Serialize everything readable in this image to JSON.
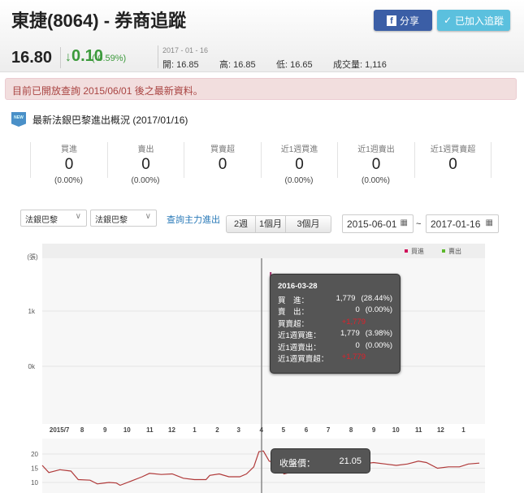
{
  "header": {
    "title": "東捷(8064) - 券商追蹤",
    "share_label": "分享",
    "track_label": "已加入追蹤"
  },
  "quote": {
    "price": "16.80",
    "change": "0.10",
    "change_pct": "(-0.59%)",
    "date": "2017 - 01 - 16",
    "open": "開: 16.85",
    "high": "高: 16.85",
    "low": "低: 16.65",
    "volume": "成交量: 1,116",
    "up_color": "#3c9a3c"
  },
  "alert": "目前已開放查詢 2015/06/01 後之最新資料。",
  "section": {
    "icon_text": "NEW",
    "title": "最新法銀巴黎進出概況 (2017/01/16)"
  },
  "stats": [
    {
      "label": "買進",
      "value": "0",
      "pct": "(0.00%)"
    },
    {
      "label": "賣出",
      "value": "0",
      "pct": "(0.00%)"
    },
    {
      "label": "買賣超",
      "value": "0",
      "pct": ""
    },
    {
      "label": "近1週買進",
      "value": "0",
      "pct": "(0.00%)"
    },
    {
      "label": "近1週賣出",
      "value": "0",
      "pct": "(0.00%)"
    },
    {
      "label": "近1週買賣超",
      "value": "0",
      "pct": ""
    }
  ],
  "controls": {
    "broker1": "法銀巴黎",
    "broker2": "法銀巴黎",
    "query_link": "查詢主力進出",
    "periods": [
      "2週",
      "1個月",
      "3個月"
    ],
    "date_from": "2015-06-01",
    "date_to": "2017-01-16",
    "tilde": "~"
  },
  "chart_data": [
    {
      "type": "bar",
      "title": "",
      "ylabel": "(張)",
      "yticks": [
        "1k",
        "0k"
      ],
      "legend": [
        {
          "name": "買進",
          "color": "#d0105a"
        },
        {
          "name": "賣出",
          "color": "#5cb82c"
        }
      ],
      "legend_position": "top-right",
      "x_range": [
        "2015-06-01",
        "2017-01-16"
      ],
      "x_ticks": [
        {
          "date": "2015-07-01",
          "label": "2015/7"
        },
        {
          "date": "2015-08-01",
          "label": "8"
        },
        {
          "date": "2015-09-01",
          "label": "9"
        },
        {
          "date": "2015-10-01",
          "label": "10"
        },
        {
          "date": "2015-11-01",
          "label": "11"
        },
        {
          "date": "2015-12-01",
          "label": "12"
        },
        {
          "date": "2016-01-01",
          "label": "1"
        },
        {
          "date": "2016-02-01",
          "label": "2"
        },
        {
          "date": "2016-03-01",
          "label": "3"
        },
        {
          "date": "2016-04-01",
          "label": "4"
        },
        {
          "date": "2016-05-01",
          "label": "5"
        },
        {
          "date": "2016-06-01",
          "label": "6"
        },
        {
          "date": "2016-07-01",
          "label": "7"
        },
        {
          "date": "2016-08-01",
          "label": "8"
        },
        {
          "date": "2016-09-01",
          "label": "9"
        },
        {
          "date": "2016-10-01",
          "label": "10"
        },
        {
          "date": "2016-11-01",
          "label": "11"
        },
        {
          "date": "2016-12-01",
          "label": "12"
        },
        {
          "date": "2017-01-01",
          "label": "1"
        }
      ],
      "bars": [
        {
          "date": "2016-03-28",
          "buy": 1779,
          "sell": 0
        }
      ],
      "tooltip": {
        "date": "2016-03-28",
        "rows": [
          {
            "k": "買　進：",
            "n": "1,779",
            "p": "(28.44%)",
            "red": false
          },
          {
            "k": "賣　出：",
            "n": "0",
            "p": "(0.00%)",
            "red": false
          },
          {
            "k": "買賣超：",
            "n": "+1,779",
            "p": "",
            "red": true
          },
          {
            "k": "近1週買進：",
            "n": "1,779",
            "p": "(3.98%)",
            "red": false
          },
          {
            "k": "近1週賣出：",
            "n": "0",
            "p": "(0.00%)",
            "red": false
          },
          {
            "k": "近1週買賣超：",
            "n": "+1,779",
            "p": "",
            "red": true
          }
        ]
      }
    },
    {
      "type": "line",
      "name": "收盤價",
      "ylim": [
        8,
        22
      ],
      "yticks": [
        20,
        15,
        10
      ],
      "color": "#b03a3a",
      "tooltip": {
        "label": "收盤價：",
        "value": "21.05"
      },
      "points": [
        [
          "2015-06-01",
          16
        ],
        [
          "2015-06-10",
          13.5
        ],
        [
          "2015-06-25",
          14.5
        ],
        [
          "2015-07-10",
          14
        ],
        [
          "2015-07-20",
          11
        ],
        [
          "2015-08-05",
          10.8
        ],
        [
          "2015-08-15",
          9.5
        ],
        [
          "2015-08-31",
          10
        ],
        [
          "2015-09-10",
          9.8
        ],
        [
          "2015-09-15",
          9
        ],
        [
          "2015-09-30",
          10.5
        ],
        [
          "2015-10-15",
          12
        ],
        [
          "2015-10-25",
          13.2
        ],
        [
          "2015-11-10",
          12.8
        ],
        [
          "2015-11-25",
          13
        ],
        [
          "2015-12-10",
          11.5
        ],
        [
          "2015-12-25",
          11
        ],
        [
          "2016-01-10",
          11
        ],
        [
          "2016-01-15",
          12.5
        ],
        [
          "2016-01-28",
          13
        ],
        [
          "2016-02-10",
          12
        ],
        [
          "2016-02-25",
          12
        ],
        [
          "2016-03-05",
          13
        ],
        [
          "2016-03-15",
          15.5
        ],
        [
          "2016-03-22",
          20.8
        ],
        [
          "2016-03-28",
          21.05
        ],
        [
          "2016-04-05",
          17.5
        ],
        [
          "2016-04-15",
          17
        ],
        [
          "2016-04-25",
          13
        ],
        [
          "2016-05-10",
          14
        ],
        [
          "2016-05-25",
          14
        ],
        [
          "2016-06-05",
          16
        ],
        [
          "2016-06-15",
          14.5
        ],
        [
          "2016-06-30",
          14.5
        ],
        [
          "2016-07-10",
          16.5
        ],
        [
          "2016-07-25",
          16
        ],
        [
          "2016-08-10",
          16.5
        ],
        [
          "2016-08-25",
          17
        ],
        [
          "2016-09-10",
          16.5
        ],
        [
          "2016-09-25",
          16
        ],
        [
          "2016-10-10",
          16.5
        ],
        [
          "2016-10-25",
          17.5
        ],
        [
          "2016-11-05",
          17
        ],
        [
          "2016-11-20",
          15
        ],
        [
          "2016-12-05",
          15.5
        ],
        [
          "2016-12-20",
          15.5
        ],
        [
          "2017-01-01",
          16.5
        ],
        [
          "2017-01-16",
          16.8
        ]
      ]
    }
  ]
}
